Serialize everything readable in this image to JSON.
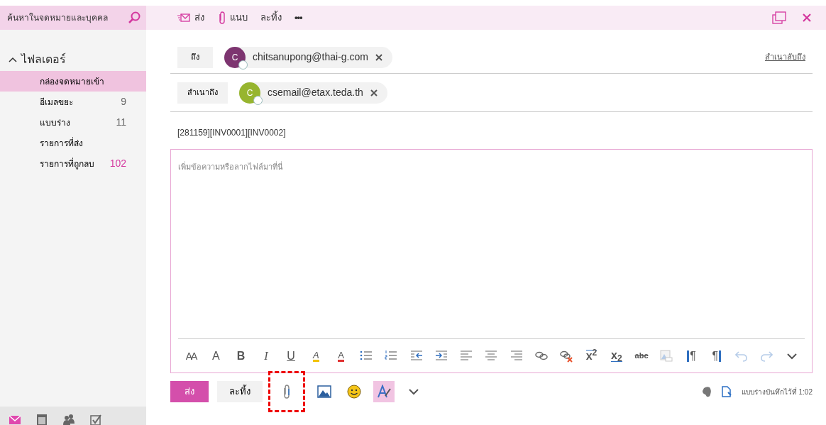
{
  "search": {
    "placeholder": "ค้นหาในจดหมายและบุคคล"
  },
  "toolbar": [
    {
      "kind": "send",
      "label": "ส่ง"
    },
    {
      "kind": "attach",
      "label": "แนบ"
    },
    {
      "kind": "discard",
      "label": "ละทิ้ง"
    },
    {
      "kind": "more",
      "label": "•••"
    }
  ],
  "window_actions": [
    {
      "kind": "popout"
    },
    {
      "kind": "close"
    }
  ],
  "folders": {
    "title": "ไฟลเดอร์",
    "expanded": true,
    "items": [
      {
        "label": "กล่องจดหมายเข้า",
        "selected": true
      },
      {
        "label": "อีเมลขยะ",
        "count": "9",
        "color": "#666666",
        "selected": false
      },
      {
        "label": "แบบร่าง",
        "count": "11",
        "color": "#666666",
        "selected": false
      },
      {
        "label": "รายการที่ส่ง",
        "selected": false
      },
      {
        "label": "รายการที่ถูกลบ",
        "count": "102",
        "color": "#d4379e",
        "selected": false
      }
    ]
  },
  "bottom_nav": [
    {
      "kind": "mail",
      "selected": true
    },
    {
      "kind": "calendar",
      "selected": false
    },
    {
      "kind": "people",
      "selected": false
    },
    {
      "kind": "tasks",
      "selected": false
    }
  ],
  "recipients": [
    {
      "label": "ถึง",
      "chips": [
        {
          "initial": "C",
          "email": "chitsanupong@thai-g.com",
          "color": "#7d3570"
        }
      ],
      "link": "สำเนาลับถึง"
    },
    {
      "label": "สำเนาถึง",
      "chips": [
        {
          "initial": "C",
          "email": "csemail@etax.teda.th",
          "color": "#97b52f"
        }
      ]
    }
  ],
  "subject": "[281159][INV0001][INV0002]",
  "body": {
    "placeholder": "เพิ่มข้อความหรือลากไฟล์มาที่นี่"
  },
  "format_tools": [
    {
      "kind": "font-size",
      "glyph": "AA",
      "disabled": false
    },
    {
      "kind": "grow-font",
      "glyph": "A",
      "disabled": false
    },
    {
      "kind": "bold",
      "glyph": "B",
      "disabled": false
    },
    {
      "kind": "italic",
      "glyph": "I",
      "disabled": false
    },
    {
      "kind": "underline",
      "glyph": "U",
      "disabled": false
    },
    {
      "kind": "highlight",
      "glyph": "A",
      "disabled": false
    },
    {
      "kind": "font-color",
      "glyph": "A",
      "disabled": false
    },
    {
      "kind": "bullets",
      "disabled": false
    },
    {
      "kind": "numbering",
      "disabled": false
    },
    {
      "kind": "outdent",
      "disabled": false
    },
    {
      "kind": "indent",
      "disabled": false
    },
    {
      "kind": "align-left",
      "disabled": false
    },
    {
      "kind": "align-center",
      "disabled": false
    },
    {
      "kind": "align-right",
      "disabled": false
    },
    {
      "kind": "link",
      "disabled": false
    },
    {
      "kind": "unlink",
      "disabled": false
    },
    {
      "kind": "superscript",
      "glyph": "x$^{2}$",
      "disabled": false
    },
    {
      "kind": "subscript",
      "glyph": "x$_{2}$",
      "disabled": false
    },
    {
      "kind": "strikethrough",
      "glyph": "abc",
      "disabled": false
    },
    {
      "kind": "image",
      "disabled": true
    },
    {
      "kind": "ltr",
      "glyph": "¶",
      "disabled": false
    },
    {
      "kind": "rtl",
      "glyph": "¶",
      "disabled": false
    },
    {
      "kind": "undo",
      "disabled": true
    },
    {
      "kind": "redo",
      "disabled": true
    },
    {
      "kind": "more",
      "disabled": false
    }
  ],
  "compose_actions": {
    "send": "ส่ง",
    "discard": "ละทิ้ง",
    "tools": [
      {
        "kind": "attach",
        "selected": false,
        "highlighted": true
      },
      {
        "kind": "image",
        "selected": false,
        "highlighted": false
      },
      {
        "kind": "emoji",
        "selected": false,
        "highlighted": false
      },
      {
        "kind": "format",
        "selected": true,
        "highlighted": false
      },
      {
        "kind": "more",
        "selected": false,
        "highlighted": false
      }
    ]
  },
  "status": {
    "icons": [
      {
        "kind": "evernote"
      },
      {
        "kind": "draft"
      }
    ],
    "text": "แบบร่างบันทึกไว้ที่ 1:02"
  }
}
